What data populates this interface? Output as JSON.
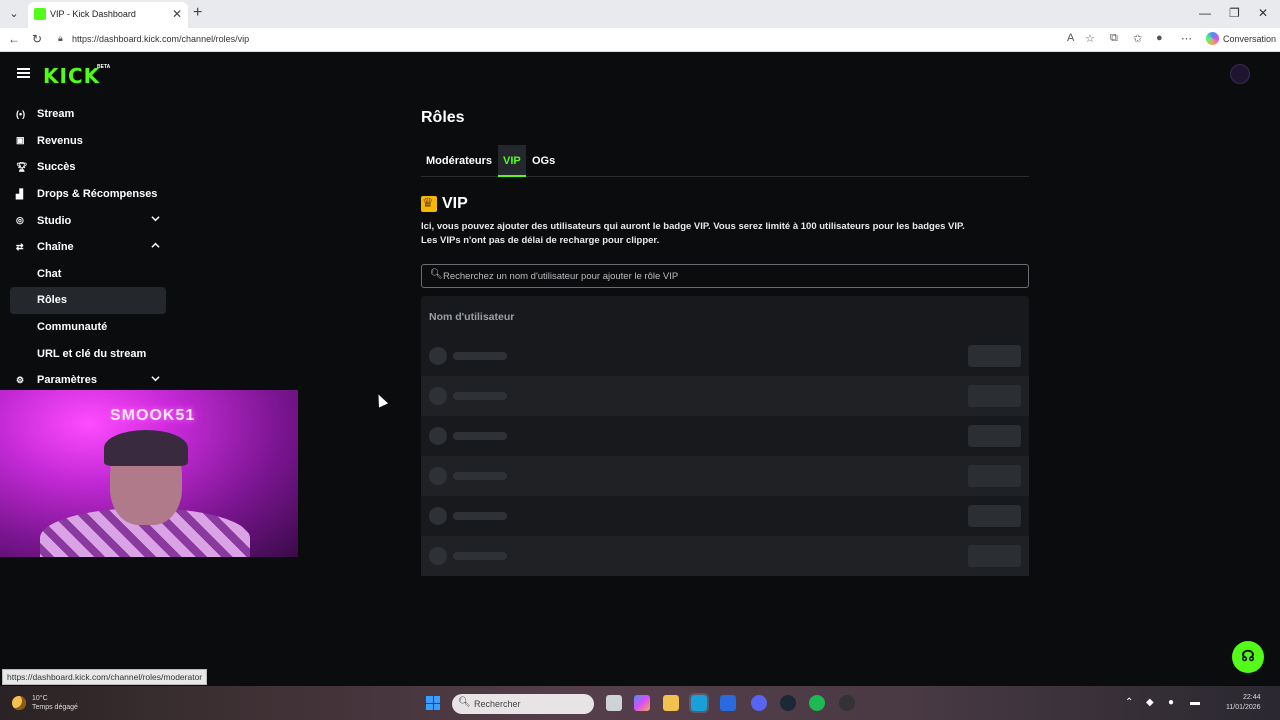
{
  "browser": {
    "tab_title": "VIP - Kick Dashboard",
    "url": "https://dashboard.kick.com/channel/roles/vip",
    "conversation_label": "Conversation",
    "status_url": "https://dashboard.kick.com/channel/roles/moderator"
  },
  "app": {
    "logo": "KICK",
    "logo_badge": "BETA"
  },
  "sidebar": {
    "items": [
      {
        "label": "Stream",
        "icon": "broadcast-icon"
      },
      {
        "label": "Revenus",
        "icon": "revenue-icon"
      },
      {
        "label": "Succès",
        "icon": "trophy-icon"
      },
      {
        "label": "Drops & Récompenses",
        "icon": "drops-icon"
      },
      {
        "label": "Studio",
        "icon": "studio-icon",
        "expanded": false
      },
      {
        "label": "Chaîne",
        "icon": "channel-icon",
        "expanded": true
      },
      {
        "label": "Paramètres",
        "icon": "gear-icon",
        "expanded": false
      }
    ],
    "channel_sub": [
      {
        "label": "Chat",
        "active": false
      },
      {
        "label": "Rôles",
        "active": true
      },
      {
        "label": "Communauté",
        "active": false
      },
      {
        "label": "URL et clé du stream",
        "active": false
      }
    ]
  },
  "main": {
    "title": "Rôles",
    "tabs": [
      {
        "label": "Modérateurs",
        "active": false
      },
      {
        "label": "VIP",
        "active": true
      },
      {
        "label": "OGs",
        "active": false
      }
    ],
    "section_title": "VIP",
    "description_line1": "Ici, vous pouvez ajouter des utilisateurs qui auront le badge VIP. Vous serez limité à 100 utilisateurs pour les badges VIP.",
    "description_line2": "Les VIPs n'ont pas de délai de recharge pour clipper.",
    "search_placeholder": "Recherchez un nom d'utilisateur pour ajouter le rôle VIP",
    "table_header": "Nom d'utilisateur",
    "loading_rows": 6
  },
  "webcam": {
    "neon_text": "SMOOK51"
  },
  "taskbar": {
    "weather_temp": "10°C",
    "weather_desc": "Temps dégagé",
    "search_label": "Rechercher",
    "time": "22:44",
    "date": "11/01/2026"
  },
  "colors": {
    "accent": "#53fc18",
    "background": "#0b0c0e",
    "active_item": "#24272c",
    "crown": "#f5b800"
  }
}
